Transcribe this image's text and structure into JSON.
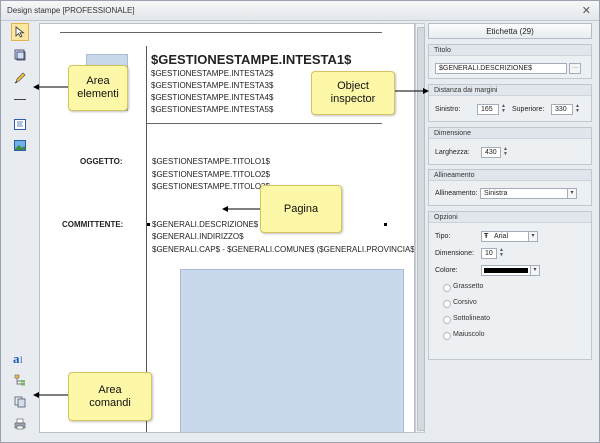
{
  "window": {
    "title": "Design stampe [PROFESSIONALE]"
  },
  "toolbar": {
    "top_icons": [
      "pointer-icon",
      "frame-icon",
      "pencil-icon",
      "line-icon",
      "text-field-icon",
      "image-icon"
    ],
    "bottom_icons": [
      "font-icon",
      "tree-icon",
      "copy-icon",
      "print-icon"
    ]
  },
  "document": {
    "intesta1": "$GESTIONESTAMPE.INTESTA1$",
    "intesta_lines": [
      "$GESTIONESTAMPE.INTESTA2$",
      "$GESTIONESTAMPE.INTESTA3$",
      "$GESTIONESTAMPE.INTESTA4$",
      "$GESTIONESTAMPE.INTESTA5$"
    ],
    "oggetto_label": "OGGETTO:",
    "titoli": [
      "$GESTIONESTAMPE.TITOLO1$",
      "$GESTIONESTAMPE.TITOLO2$",
      "$GESTIONESTAMPE.TITOLO3$"
    ],
    "committente_label": "COMMITTENTE:",
    "committente_lines": [
      "$GENERALI.DESCRIZIONE$",
      "$GENERALI.INDIRIZZO$",
      "$GENERALI.CAP$ - $GENERALI.COMUNE$ ($GENERALI.PROVINCIA$)"
    ]
  },
  "inspector": {
    "tab": "Etichetta (29)",
    "titolo": {
      "header": "Titolo",
      "value": "$GENERALI.DESCRIZIONE$",
      "browse": "···"
    },
    "margini": {
      "header": "Distanza dai margini",
      "sinistro_label": "Sinistro:",
      "sinistro": "165",
      "superiore_label": "Superiore:",
      "superiore": "330"
    },
    "dimensione": {
      "header": "Dimensione",
      "larghezza_label": "Larghezza:",
      "larghezza": "430"
    },
    "allineamento": {
      "header": "Allineamento",
      "label": "Allineamento:",
      "value": "Sinistra"
    },
    "opzioni": {
      "header": "Opzioni",
      "tipo_label": "Tipo:",
      "tipo": "Arial",
      "dimensione_label": "Dimensione:",
      "dimensione": "10",
      "colore_label": "Colore:",
      "checks": [
        "Grassetto",
        "Corsivo",
        "Sottolineato",
        "Maiuscolo"
      ]
    }
  },
  "callouts": {
    "area_elementi": "Area\nelementi",
    "object_inspector": "Object\ninspector",
    "pagina": "Pagina",
    "area_comandi": "Area\ncomandi"
  },
  "colors": {
    "callout_bg": "#fdf7a8",
    "selected_tool": "#fbe6a2",
    "placeholder_blue": "#c9d8ea"
  }
}
